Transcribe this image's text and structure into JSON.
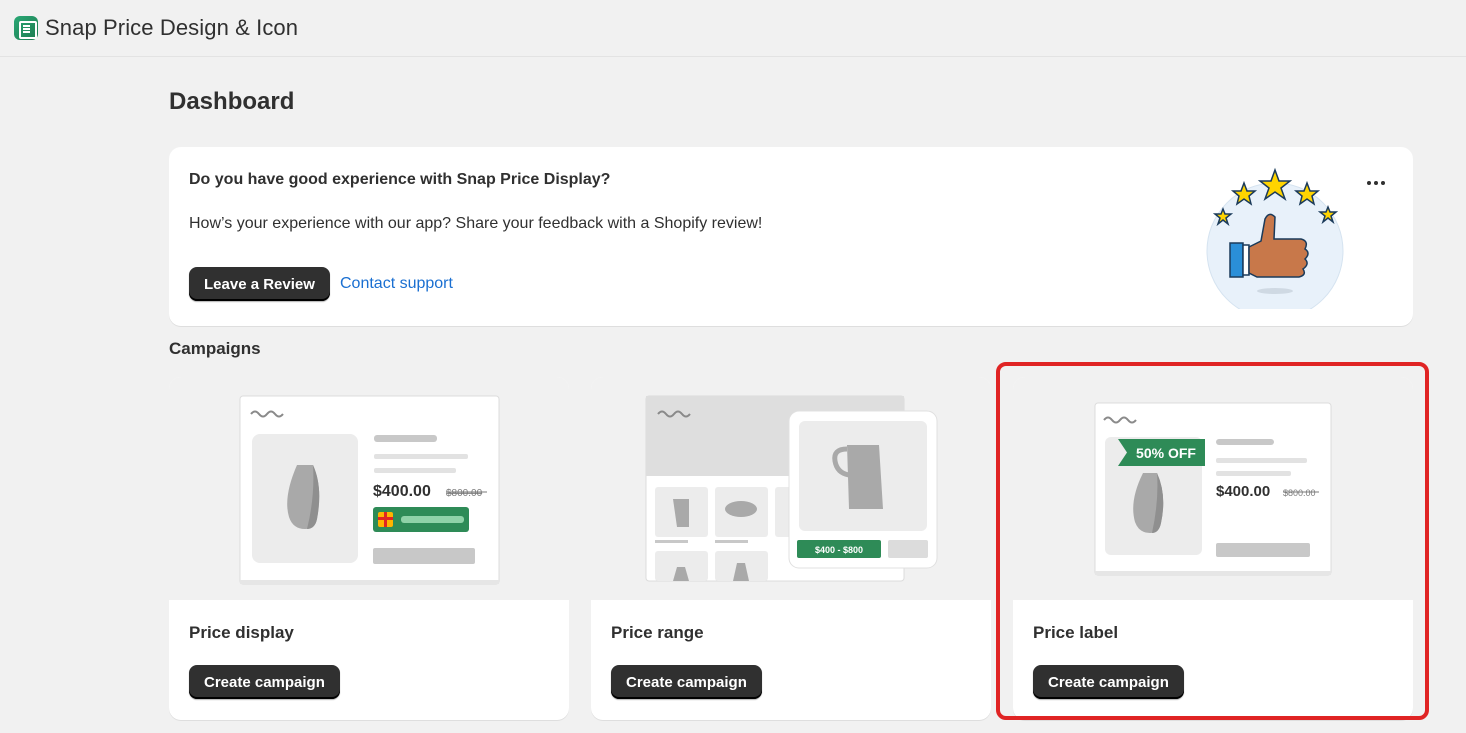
{
  "app": {
    "title": "Snap Price Design & Icon",
    "icon": "app-logo-icon"
  },
  "page": {
    "title": "Dashboard"
  },
  "review_banner": {
    "heading": "Do you have good experience with Snap Price Display?",
    "body": "How’s your experience with our app? Share your feedback with a Shopify review!",
    "review_button": "Leave a Review",
    "support_link": "Contact support",
    "menu_icon": "more-horizontal-icon",
    "illustration": "thumbs-up-stars-icon"
  },
  "campaigns": {
    "title": "Campaigns",
    "cards": [
      {
        "title": "Price display",
        "button": "Create campaign",
        "preview": {
          "price": "$400.00",
          "compare_price": "$800.00"
        }
      },
      {
        "title": "Price range",
        "button": "Create campaign",
        "preview": {
          "range": "$400 - $800"
        }
      },
      {
        "title": "Price label",
        "button": "Create campaign",
        "preview": {
          "badge": "50% OFF",
          "price": "$400.00",
          "compare_price": "$800.00"
        }
      }
    ]
  },
  "colors": {
    "primary_button": "#303030",
    "link": "#1a6fd1",
    "highlight": "#e02424",
    "accent_green": "#2e8b57"
  }
}
